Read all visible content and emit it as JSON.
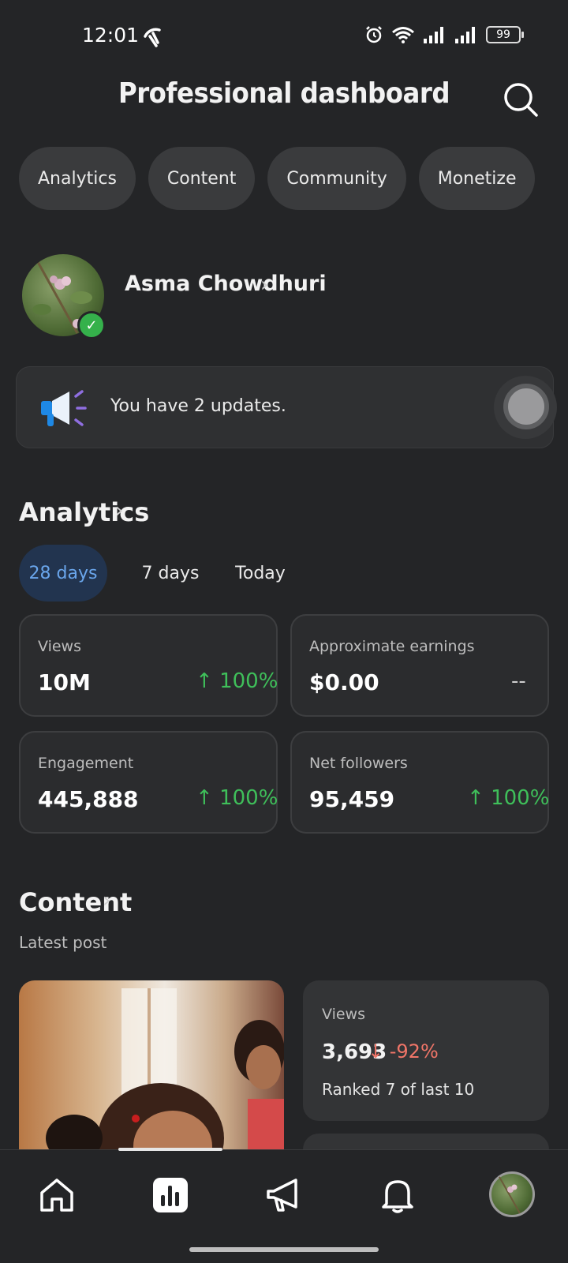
{
  "status_bar": {
    "time": "12:01",
    "battery": "99"
  },
  "header": {
    "title": "Professional dashboard"
  },
  "chips": [
    "Analytics",
    "Content",
    "Community",
    "Monetize"
  ],
  "profile": {
    "name": "Asma Chowdhuri"
  },
  "banner": {
    "text": "You have 2 updates."
  },
  "analytics": {
    "title": "Analytics",
    "ranges": [
      "28 days",
      "7 days",
      "Today"
    ],
    "selected_range": "28 days",
    "cards": [
      {
        "label": "Views",
        "value": "10M",
        "delta": "100%"
      },
      {
        "label": "Approximate earnings",
        "value": "$0.00",
        "delta": "--"
      },
      {
        "label": "Engagement",
        "value": "445,888",
        "delta": "100%"
      },
      {
        "label": "Net followers",
        "value": "95,459",
        "delta": "100%"
      }
    ]
  },
  "content": {
    "title": "Content",
    "latest_label": "Latest post",
    "post": {
      "views_label": "Views",
      "views_value": "3,693",
      "views_delta": "-92%",
      "rank": "Ranked 7 of last 10"
    }
  },
  "colors": {
    "background": "#242527",
    "positive": "#3fbf5a",
    "negative": "#f07568",
    "active_tab": "#6aa6ec",
    "verified": "#35b14b"
  },
  "icons": [
    "carrier-icon",
    "alarm-icon",
    "wifi-icon",
    "signal-icon",
    "search-icon",
    "megaphone-icon",
    "home-icon",
    "insights-icon",
    "ads-icon",
    "bell-icon"
  ]
}
